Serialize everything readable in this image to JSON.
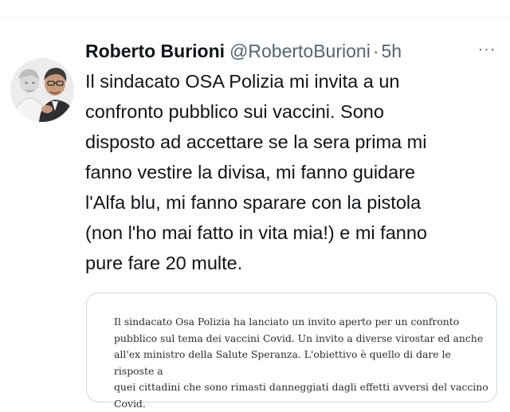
{
  "tweet": {
    "author_name": "Roberto Burioni",
    "handle": "@RobertoBurioni",
    "separator": "·",
    "timestamp": "5h",
    "more_icon": "···",
    "text": "Il sindacato OSA Polizia mi invita a un\nconfronto pubblico sui vaccini. Sono\ndisposto ad accettare se la sera prima mi\nfanno vestire la divisa, mi fanno guidare\nl'Alfa blu, mi fanno sparare con la pistola\n(non l'ho mai fatto in vita mia!) e mi fanno\npure fare 20 multe."
  },
  "quote": {
    "text": "Il sindacato Osa Polizia ha lanciato un invito aperto per un confronto\npubblico sul tema dei vaccini Covid. Un invito a diverse virostar ed anche\nall'ex ministro della Salute Speranza. L'obiettivo è quello di dare le risposte a\nquei cittadini che sono rimasti danneggiati dagli effetti avversi del vaccino\nCovid."
  },
  "colors": {
    "text_primary": "#0f1419",
    "text_secondary": "#536471",
    "border": "#cfd9de"
  },
  "icons": {
    "more": "more-icon",
    "avatar": "avatar"
  }
}
